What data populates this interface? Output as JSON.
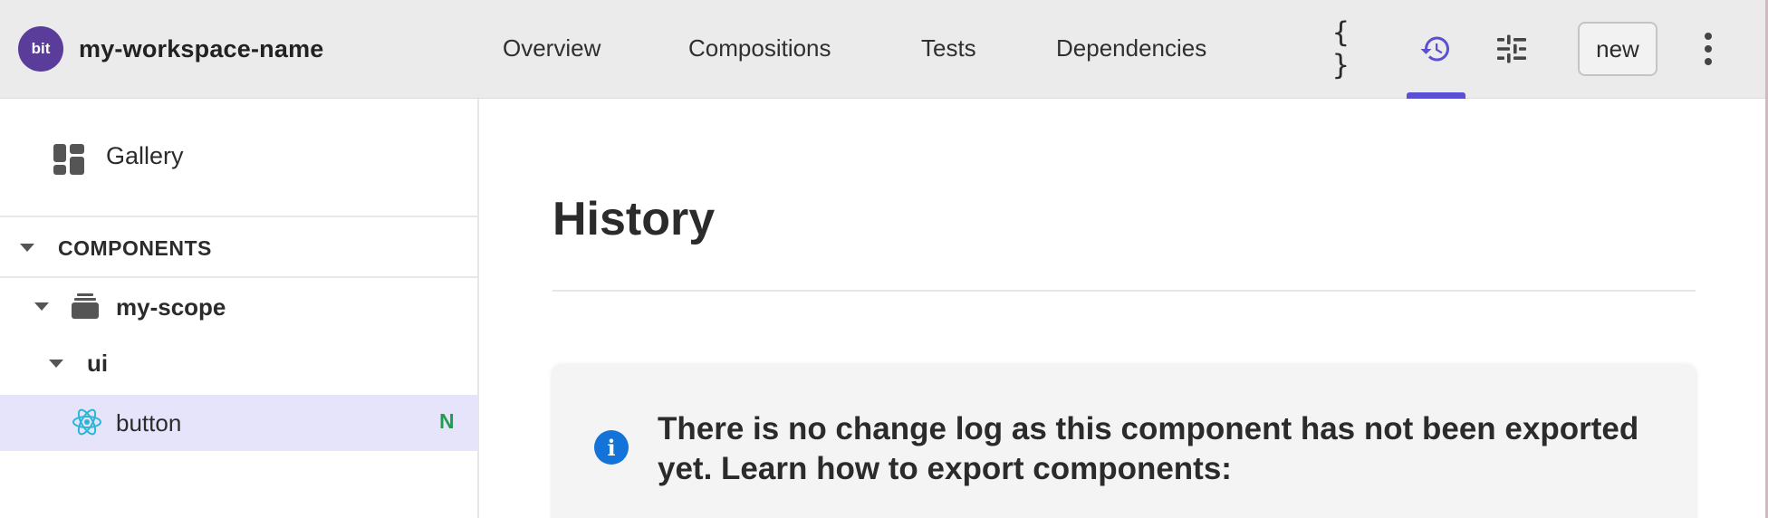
{
  "workspace": {
    "logo_text": "bit",
    "name": "my-workspace-name"
  },
  "nav_tabs": [
    {
      "label": "Overview"
    },
    {
      "label": "Compositions"
    },
    {
      "label": "Tests"
    },
    {
      "label": "Dependencies"
    }
  ],
  "toolbar": {
    "code_icon_label": "{ }",
    "active_tool": "history",
    "new_label": "new"
  },
  "sidebar": {
    "gallery_label": "Gallery",
    "components_header": "COMPONENTS",
    "tree": [
      {
        "label": "my-scope",
        "type": "scope"
      },
      {
        "label": "ui",
        "type": "namespace"
      },
      {
        "label": "button",
        "type": "component",
        "badge": "N",
        "selected": true
      }
    ]
  },
  "main": {
    "title": "History",
    "notice_text": "There is no change log as this component has not been exported yet. Learn how to export components:"
  },
  "colors": {
    "accent": "#5b4fd6",
    "workspace_logo": "#5a3d9a",
    "selected_row": "#e6e4fb",
    "info_icon": "#1473d8",
    "badge_new": "#1e9e4e"
  }
}
